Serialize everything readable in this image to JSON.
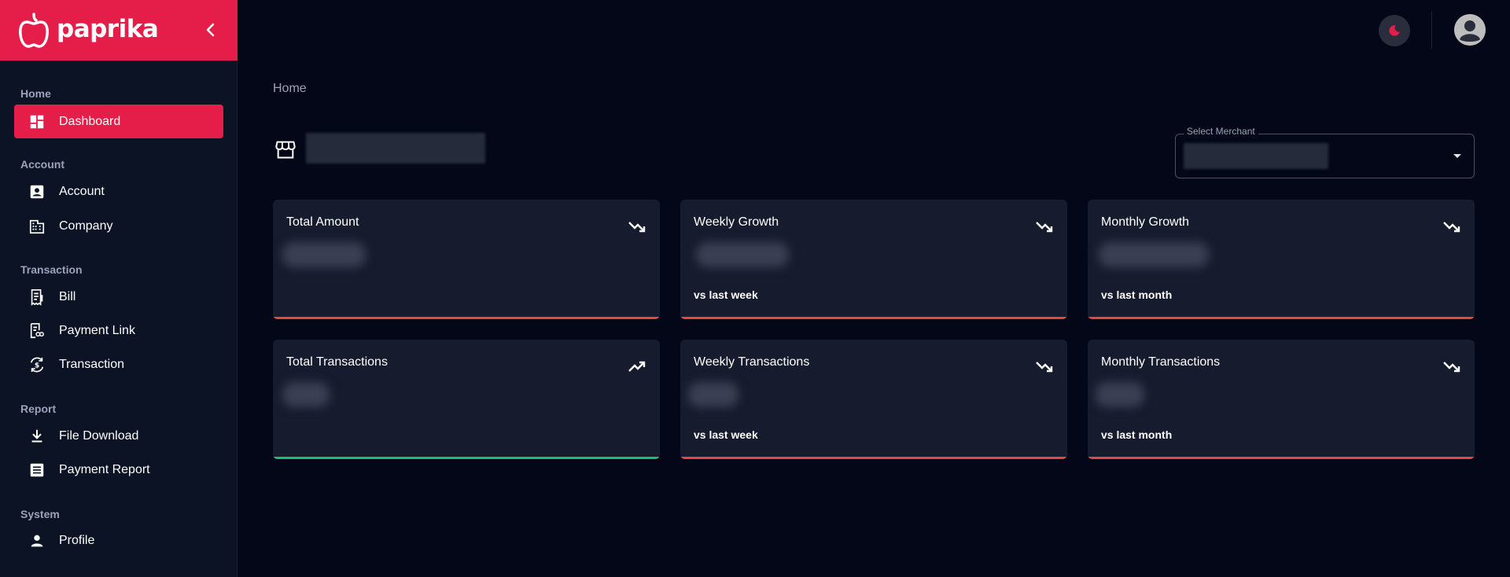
{
  "brand": {
    "name": "paprika"
  },
  "colors": {
    "accent": "#e51d49",
    "negative": "#e5483e",
    "positive": "#1fb97a",
    "background": "#040717",
    "card": "#161b2d",
    "sidebar": "#0c1325"
  },
  "sidebar": {
    "sections": [
      {
        "label": "Home"
      },
      {
        "label": "Account"
      },
      {
        "label": "Transaction"
      },
      {
        "label": "Report"
      },
      {
        "label": "System"
      }
    ],
    "items": [
      {
        "label": "Dashboard",
        "icon": "dashboard-icon",
        "active": true
      },
      {
        "label": "Account",
        "icon": "account-box-icon"
      },
      {
        "label": "Company",
        "icon": "company-building-icon"
      },
      {
        "label": "Bill",
        "icon": "receipt-icon"
      },
      {
        "label": "Payment Link",
        "icon": "payment-link-icon"
      },
      {
        "label": "Transaction",
        "icon": "currency-exchange-icon"
      },
      {
        "label": "File Download",
        "icon": "download-icon"
      },
      {
        "label": "Payment Report",
        "icon": "report-list-icon"
      },
      {
        "label": "Profile",
        "icon": "person-icon"
      }
    ]
  },
  "header": {
    "theme_icon": "moon-icon",
    "avatar_icon": "user-avatar-icon"
  },
  "breadcrumb": "Home",
  "merchant": {
    "label": "Select Merchant"
  },
  "cards": [
    {
      "title": "Total Amount",
      "subtitle": "",
      "trend": "down"
    },
    {
      "title": "Weekly Growth",
      "subtitle": "vs last week",
      "trend": "down"
    },
    {
      "title": "Monthly Growth",
      "subtitle": "vs last month",
      "trend": "down"
    },
    {
      "title": "Total Transactions",
      "subtitle": "",
      "trend": "up"
    },
    {
      "title": "Weekly Transactions",
      "subtitle": "vs last week",
      "trend": "down"
    },
    {
      "title": "Monthly Transactions",
      "subtitle": "vs last month",
      "trend": "down"
    }
  ]
}
